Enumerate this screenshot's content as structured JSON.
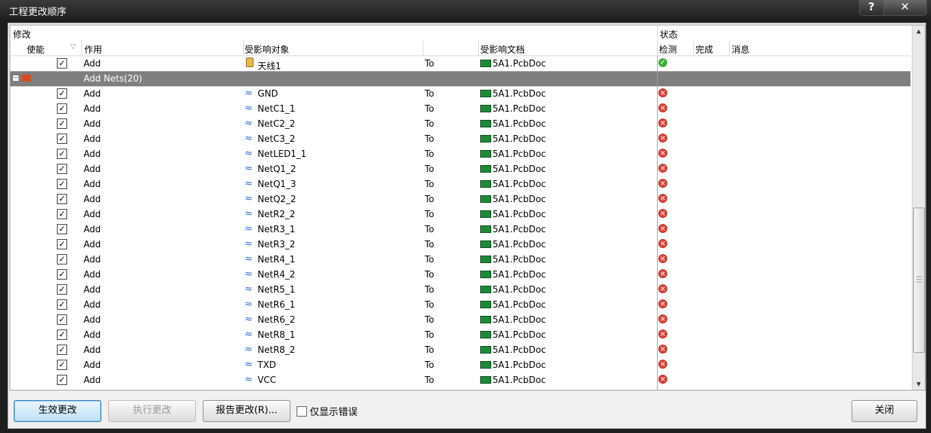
{
  "window": {
    "title": "工程更改顺序",
    "help_label": "?",
    "close_label": "✕"
  },
  "header": {
    "group_modify": "修改",
    "group_status": "状态",
    "col_enable": "使能",
    "col_action": "作用",
    "col_object": "受影响对象",
    "col_doc": "受影响文档",
    "col_check": "检测",
    "col_done": "完成",
    "col_msg": "消息"
  },
  "rows": [
    {
      "kind": "item",
      "checked": true,
      "action": "Add",
      "icon": "component-icon",
      "object": "天线1",
      "to": "To",
      "doc": "5A1.PcbDoc",
      "status": "ok"
    },
    {
      "kind": "group",
      "label": "Add Nets(20)"
    },
    {
      "kind": "item",
      "checked": true,
      "action": "Add",
      "icon": "net-icon",
      "object": "GND",
      "to": "To",
      "doc": "5A1.PcbDoc",
      "status": "error"
    },
    {
      "kind": "item",
      "checked": true,
      "action": "Add",
      "icon": "net-icon",
      "object": "NetC1_1",
      "to": "To",
      "doc": "5A1.PcbDoc",
      "status": "error"
    },
    {
      "kind": "item",
      "checked": true,
      "action": "Add",
      "icon": "net-icon",
      "object": "NetC2_2",
      "to": "To",
      "doc": "5A1.PcbDoc",
      "status": "error"
    },
    {
      "kind": "item",
      "checked": true,
      "action": "Add",
      "icon": "net-icon",
      "object": "NetC3_2",
      "to": "To",
      "doc": "5A1.PcbDoc",
      "status": "error"
    },
    {
      "kind": "item",
      "checked": true,
      "action": "Add",
      "icon": "net-icon",
      "object": "NetLED1_1",
      "to": "To",
      "doc": "5A1.PcbDoc",
      "status": "error"
    },
    {
      "kind": "item",
      "checked": true,
      "action": "Add",
      "icon": "net-icon",
      "object": "NetQ1_2",
      "to": "To",
      "doc": "5A1.PcbDoc",
      "status": "error"
    },
    {
      "kind": "item",
      "checked": true,
      "action": "Add",
      "icon": "net-icon",
      "object": "NetQ1_3",
      "to": "To",
      "doc": "5A1.PcbDoc",
      "status": "error"
    },
    {
      "kind": "item",
      "checked": true,
      "action": "Add",
      "icon": "net-icon",
      "object": "NetQ2_2",
      "to": "To",
      "doc": "5A1.PcbDoc",
      "status": "error"
    },
    {
      "kind": "item",
      "checked": true,
      "action": "Add",
      "icon": "net-icon",
      "object": "NetR2_2",
      "to": "To",
      "doc": "5A1.PcbDoc",
      "status": "error"
    },
    {
      "kind": "item",
      "checked": true,
      "action": "Add",
      "icon": "net-icon",
      "object": "NetR3_1",
      "to": "To",
      "doc": "5A1.PcbDoc",
      "status": "error"
    },
    {
      "kind": "item",
      "checked": true,
      "action": "Add",
      "icon": "net-icon",
      "object": "NetR3_2",
      "to": "To",
      "doc": "5A1.PcbDoc",
      "status": "error"
    },
    {
      "kind": "item",
      "checked": true,
      "action": "Add",
      "icon": "net-icon",
      "object": "NetR4_1",
      "to": "To",
      "doc": "5A1.PcbDoc",
      "status": "error"
    },
    {
      "kind": "item",
      "checked": true,
      "action": "Add",
      "icon": "net-icon",
      "object": "NetR4_2",
      "to": "To",
      "doc": "5A1.PcbDoc",
      "status": "error"
    },
    {
      "kind": "item",
      "checked": true,
      "action": "Add",
      "icon": "net-icon",
      "object": "NetR5_1",
      "to": "To",
      "doc": "5A1.PcbDoc",
      "status": "error"
    },
    {
      "kind": "item",
      "checked": true,
      "action": "Add",
      "icon": "net-icon",
      "object": "NetR6_1",
      "to": "To",
      "doc": "5A1.PcbDoc",
      "status": "error"
    },
    {
      "kind": "item",
      "checked": true,
      "action": "Add",
      "icon": "net-icon",
      "object": "NetR6_2",
      "to": "To",
      "doc": "5A1.PcbDoc",
      "status": "error"
    },
    {
      "kind": "item",
      "checked": true,
      "action": "Add",
      "icon": "net-icon",
      "object": "NetR8_1",
      "to": "To",
      "doc": "5A1.PcbDoc",
      "status": "error"
    },
    {
      "kind": "item",
      "checked": true,
      "action": "Add",
      "icon": "net-icon",
      "object": "NetR8_2",
      "to": "To",
      "doc": "5A1.PcbDoc",
      "status": "error"
    },
    {
      "kind": "item",
      "checked": true,
      "action": "Add",
      "icon": "net-icon",
      "object": "TXD",
      "to": "To",
      "doc": "5A1.PcbDoc",
      "status": "error"
    },
    {
      "kind": "item",
      "checked": true,
      "action": "Add",
      "icon": "net-icon",
      "object": "VCC",
      "to": "To",
      "doc": "5A1.PcbDoc",
      "status": "error"
    }
  ],
  "footer": {
    "validate_button": "生效更改",
    "execute_button": "执行更改",
    "report_button": "报告更改(R)...",
    "only_errors_label": "仅显示错误",
    "only_errors_checked": false,
    "close_button": "关闭"
  },
  "colors": {
    "group_bg": "#7f7f7f",
    "ok": "#3fae3f",
    "error": "#e2443a",
    "net_icon": "#2a6bd6",
    "pcb_icon": "#1d8a3a"
  }
}
